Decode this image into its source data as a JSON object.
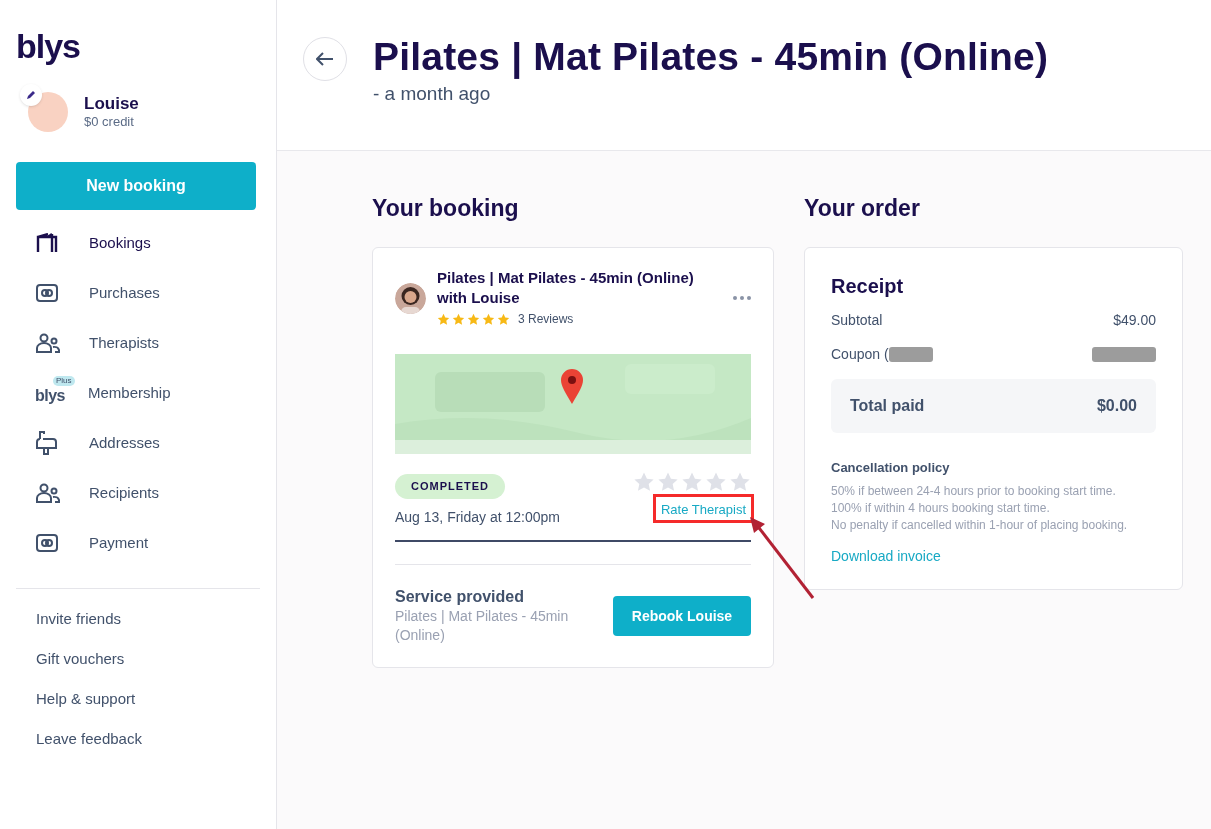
{
  "sidebar": {
    "logo": "blys",
    "user": {
      "name": "Louise",
      "credit": "$0 credit"
    },
    "new_booking": "New booking",
    "items": [
      {
        "label": "Bookings",
        "kind": "bookings",
        "selected": true
      },
      {
        "label": "Purchases",
        "kind": "card",
        "selected": false
      },
      {
        "label": "Therapists",
        "kind": "people",
        "selected": false
      },
      {
        "label": "Membership",
        "kind": "plus",
        "badge_logo": "blys",
        "badge": "Plus",
        "selected": false
      },
      {
        "label": "Addresses",
        "kind": "mailbox",
        "selected": false
      },
      {
        "label": "Recipients",
        "kind": "people",
        "selected": false
      },
      {
        "label": "Payment",
        "kind": "card",
        "selected": false
      }
    ],
    "links": [
      "Invite friends",
      "Gift vouchers",
      "Help & support",
      "Leave feedback"
    ]
  },
  "header": {
    "title": "Pilates | Mat Pilates - 45min (Online)",
    "subtitle": "- a month ago"
  },
  "booking": {
    "heading": "Your booking",
    "title": "Pilates | Mat Pilates - 45min (Online) with Louise",
    "stars": 5,
    "reviews": "3 Reviews",
    "status": "COMPLETED",
    "date": "Aug 13, Friday at 12:00pm",
    "rating": {
      "stars": 0
    },
    "rate_link": "Rate Therapist",
    "service_label": "Service provided",
    "service": "Pilates | Mat Pilates - 45min (Online)",
    "rebook": "Rebook Louise"
  },
  "order": {
    "heading": "Your order",
    "receipt": "Receipt",
    "subtotal_label": "Subtotal",
    "subtotal": "$49.00",
    "coupon_label": "Coupon (",
    "total_label": "Total paid",
    "total": "$0.00",
    "policy_heading": "Cancellation policy",
    "policy": [
      "50% if between 24-4 hours prior to booking start time.",
      "100% if within 4 hours booking start time.",
      "No penalty if cancelled within 1-hour of placing booking."
    ],
    "download": "Download invoice"
  }
}
